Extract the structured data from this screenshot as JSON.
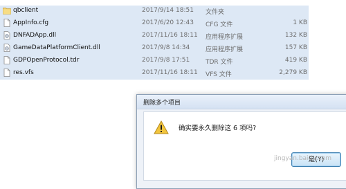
{
  "files": [
    {
      "name": "qbclient",
      "date": "2017/9/14 18:51",
      "type": "文件夹",
      "size": "",
      "icon": "folder-icon"
    },
    {
      "name": "AppInfo.cfg",
      "date": "2017/6/20 12:43",
      "type": "CFG 文件",
      "size": "1 KB",
      "icon": "file-icon"
    },
    {
      "name": "DNFADApp.dll",
      "date": "2017/11/16 18:11",
      "type": "应用程序扩展",
      "size": "132 KB",
      "icon": "dll-icon"
    },
    {
      "name": "GameDataPlatformClient.dll",
      "date": "2017/9/8 14:34",
      "type": "应用程序扩展",
      "size": "157 KB",
      "icon": "dll-icon"
    },
    {
      "name": "GDPOpenProtocol.tdr",
      "date": "2017/9/8 17:51",
      "type": "TDR 文件",
      "size": "419 KB",
      "icon": "file-icon"
    },
    {
      "name": "res.vfs",
      "date": "2017/11/16 18:11",
      "type": "VFS 文件",
      "size": "2,279 KB",
      "icon": "file-icon"
    }
  ],
  "dialog": {
    "title": "删除多个项目",
    "message": "确实要永久删除这 6 项吗?",
    "yes_label": "是(Y)",
    "icon": "warning-icon"
  },
  "watermark": "jingyan.baidu.com",
  "colors": {
    "selection": "#dde8f5",
    "accent": "#3c7fb1",
    "warning": "#f2c53d"
  }
}
